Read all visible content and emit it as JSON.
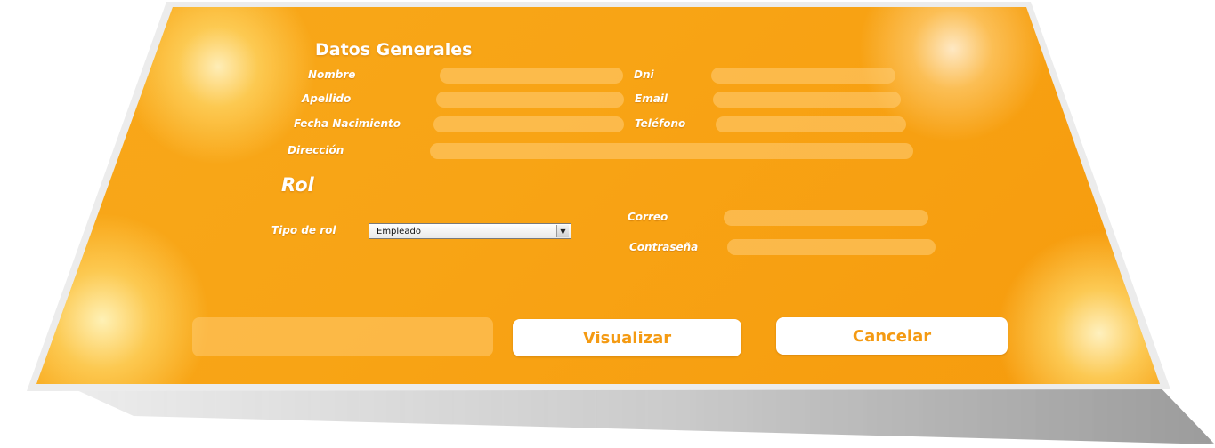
{
  "general": {
    "title": "Datos Generales",
    "nombre_label": "Nombre",
    "apellido_label": "Apellido",
    "fecha_label": "Fecha Nacimiento",
    "direccion_label": "Dirección",
    "dni_label": "Dni",
    "email_label": "Email",
    "telefono_label": "Teléfono",
    "nombre_value": "",
    "apellido_value": "",
    "fecha_value": "",
    "direccion_value": "",
    "dni_value": "",
    "email_value": "",
    "telefono_value": ""
  },
  "rol": {
    "title": "Rol",
    "tipo_label": "Tipo de rol",
    "tipo_selected": "Empleado",
    "correo_label": "Correo",
    "contrasena_label": "Contraseña",
    "correo_value": "",
    "contrasena_value": ""
  },
  "status": {
    "message": ""
  },
  "actions": {
    "visualizar_label": "Visualizar",
    "cancelar_label": "Cancelar"
  },
  "icons": {
    "dropdown": "chevron-down-icon"
  },
  "colors": {
    "background": "#f8a415",
    "button_text": "#f49a12",
    "label_text": "#ffffff"
  }
}
